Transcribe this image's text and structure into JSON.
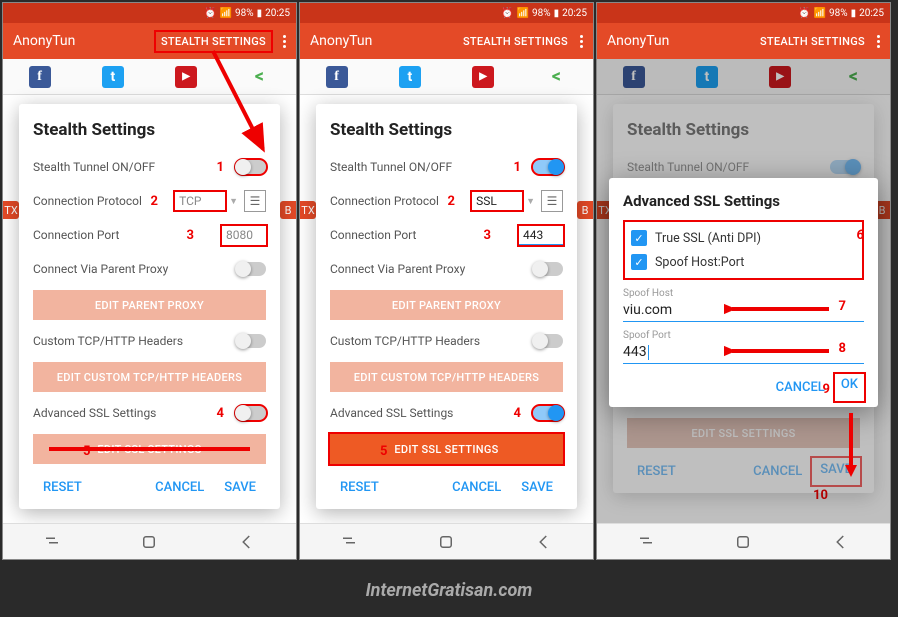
{
  "status": {
    "carrier": "",
    "battery": "98%",
    "time": "20:25"
  },
  "app": {
    "title": "AnonyTun",
    "stealth_btn": "STEALTH SETTINGS"
  },
  "edge": {
    "left": "TX",
    "right": "B"
  },
  "dialog_title": "Stealth Settings",
  "rows": {
    "tunnel": "Stealth Tunnel ON/OFF",
    "protocol": "Connection Protocol",
    "port": "Connection Port",
    "parent": "Connect Via Parent Proxy",
    "custom": "Custom TCP/HTTP Headers",
    "ssl": "Advanced SSL Settings"
  },
  "buttons": {
    "parent": "EDIT PARENT PROXY",
    "custom": "EDIT CUSTOM TCP/HTTP HEADERS",
    "ssl": "EDIT SSL SETTINGS"
  },
  "actions": {
    "reset": "RESET",
    "cancel": "CANCEL",
    "save": "SAVE",
    "ok": "OK"
  },
  "screen1": {
    "protocol": "TCP",
    "port": "8080"
  },
  "screen2": {
    "protocol": "SSL",
    "port": "443"
  },
  "ssl_dialog": {
    "title": "Advanced SSL Settings",
    "true_ssl": "True SSL (Anti DPI)",
    "spoof_hp": "Spoof Host:Port",
    "host_lbl": "Spoof Host",
    "host_val": "viu.com",
    "port_lbl": "Spoof Port",
    "port_val": "443"
  },
  "watermark": "InternetGratisan.com",
  "annot": {
    "n1": "1",
    "n2": "2",
    "n3": "3",
    "n4": "4",
    "n5": "5",
    "n6": "6",
    "n7": "7",
    "n8": "8",
    "n9": "9",
    "n10": "10"
  }
}
